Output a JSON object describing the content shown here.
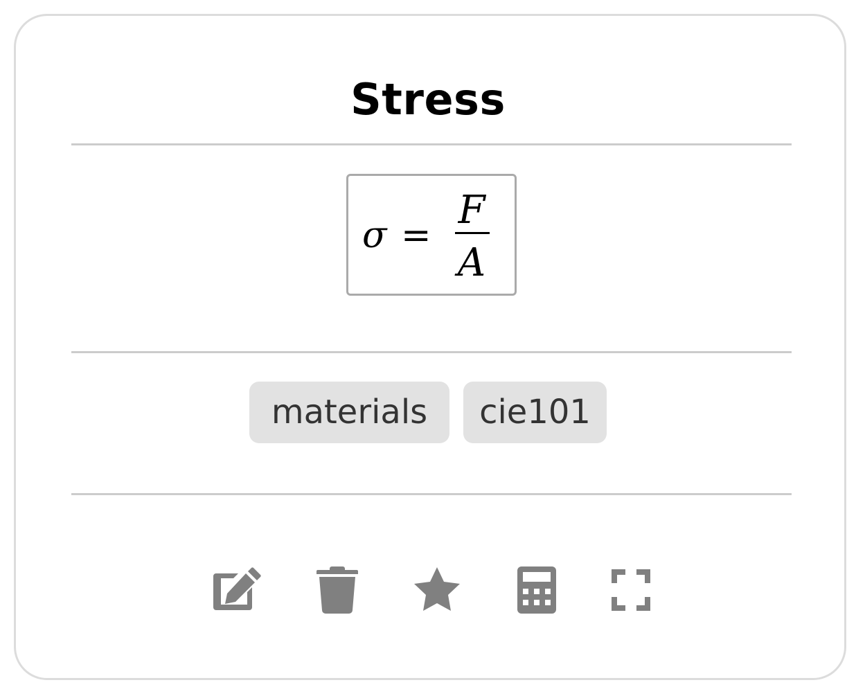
{
  "card": {
    "title": "Stress",
    "formula": {
      "lhs": "σ",
      "operator": "=",
      "numerator": "F",
      "denominator": "A"
    },
    "tags": [
      "materials",
      "cie101"
    ],
    "actions": [
      {
        "name": "edit",
        "icon": "edit-icon"
      },
      {
        "name": "delete",
        "icon": "trash-icon"
      },
      {
        "name": "favorite",
        "icon": "star-icon"
      },
      {
        "name": "calculate",
        "icon": "calculator-icon"
      },
      {
        "name": "expand",
        "icon": "expand-icon"
      }
    ],
    "icon_color": "#808080",
    "tag_background": "#e2e2e2"
  }
}
